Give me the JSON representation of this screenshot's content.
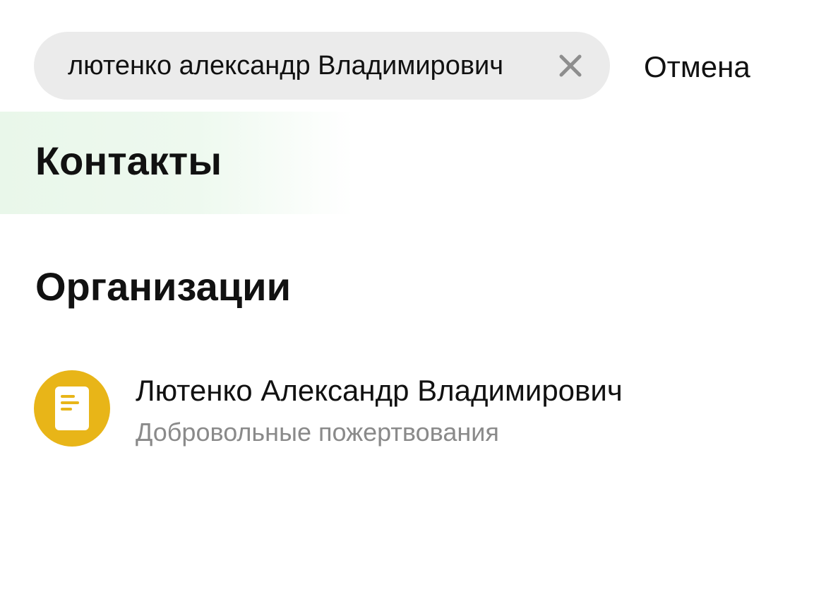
{
  "search": {
    "value": "лютенко александр Владимирович",
    "clear_icon": "close-icon"
  },
  "header": {
    "cancel_label": "Отмена"
  },
  "sections": {
    "contacts": {
      "title": "Контакты"
    },
    "organizations": {
      "title": "Организации",
      "items": [
        {
          "name": "Лютенко Александр Владимирович",
          "subtitle": "Добровольные пожертвования",
          "icon": "document-icon",
          "avatar_color": "#e8b518"
        }
      ]
    }
  },
  "colors": {
    "search_background": "#ebebeb",
    "contacts_highlight": "#e9f7ea",
    "subtitle_text": "#8a8a8a"
  }
}
